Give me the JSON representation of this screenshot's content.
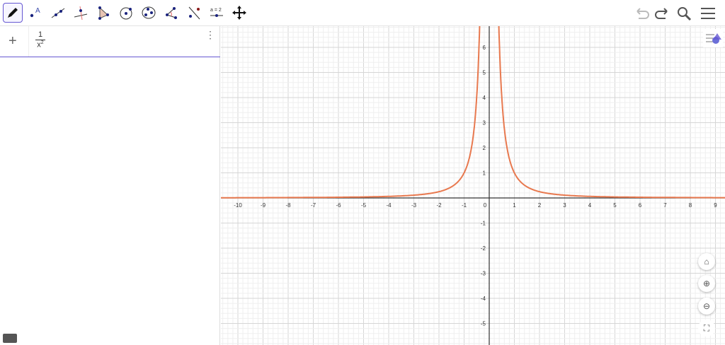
{
  "toolbar": {
    "tools": [
      {
        "name": "move-graphics-pen",
        "icon": "pen-icon",
        "active": true
      },
      {
        "name": "point",
        "icon": "point-icon",
        "label": "A"
      },
      {
        "name": "line",
        "icon": "line-icon"
      },
      {
        "name": "perpendicular-line",
        "icon": "perpendicular-icon"
      },
      {
        "name": "polygon",
        "icon": "polygon-icon"
      },
      {
        "name": "circle-center-point",
        "icon": "circle-icon"
      },
      {
        "name": "circle-three-points",
        "icon": "ellipse-icon"
      },
      {
        "name": "angle",
        "icon": "angle-icon"
      },
      {
        "name": "reflect",
        "icon": "reflect-icon"
      },
      {
        "name": "slider",
        "icon": "slider-icon",
        "label": "a = 2"
      },
      {
        "name": "move-view",
        "icon": "move-icon"
      }
    ],
    "right": [
      "undo-icon",
      "redo-icon",
      "search-icon",
      "menu-icon"
    ]
  },
  "algebra": {
    "add_label": "+",
    "expression": {
      "numerator": "1",
      "base": "x",
      "exponent": "2"
    },
    "more_label": "⋮"
  },
  "graph": {
    "function": {
      "expr": "1/x^2",
      "color": "#e8794f"
    },
    "x_ticks": [
      "-10",
      "-9",
      "-8",
      "-7",
      "-6",
      "-5",
      "-4",
      "-3",
      "-2",
      "-1",
      "0",
      "1",
      "2",
      "3",
      "4",
      "5",
      "6",
      "7",
      "8",
      "9"
    ],
    "y_ticks": [
      "-5",
      "-4",
      "-3",
      "-2",
      "-1",
      "1",
      "2",
      "3",
      "4",
      "5",
      "6"
    ],
    "view_buttons": [
      "home-icon",
      "zoom-in-icon",
      "zoom-out-icon",
      "fullscreen-icon"
    ]
  }
}
